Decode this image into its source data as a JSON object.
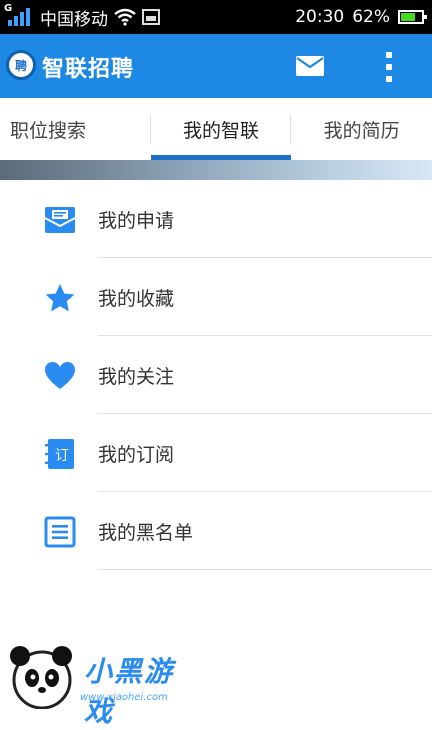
{
  "status_bar": {
    "signal_label": "G",
    "carrier": "中国移动",
    "time": "20:30",
    "battery_percent": "62%"
  },
  "app_bar": {
    "logo_text": "聘",
    "title": "智联招聘"
  },
  "tabs": [
    {
      "label": "职位搜索",
      "active": false
    },
    {
      "label": "我的智联",
      "active": true
    },
    {
      "label": "我的简历",
      "active": false
    }
  ],
  "menu": {
    "items": [
      {
        "label": "我的申请",
        "icon": "application-icon"
      },
      {
        "label": "我的收藏",
        "icon": "star-icon"
      },
      {
        "label": "我的关注",
        "icon": "heart-icon"
      },
      {
        "label": "我的订阅",
        "icon": "subscription-icon",
        "icon_text": "订"
      },
      {
        "label": "我的黑名单",
        "icon": "blacklist-icon"
      }
    ]
  },
  "watermark": {
    "title": "小黑游戏",
    "url": "www.xiaohei.com"
  },
  "colors": {
    "primary": "#1e88e5",
    "tab_indicator": "#1e6fc8",
    "icon": "#2a8cf0"
  }
}
